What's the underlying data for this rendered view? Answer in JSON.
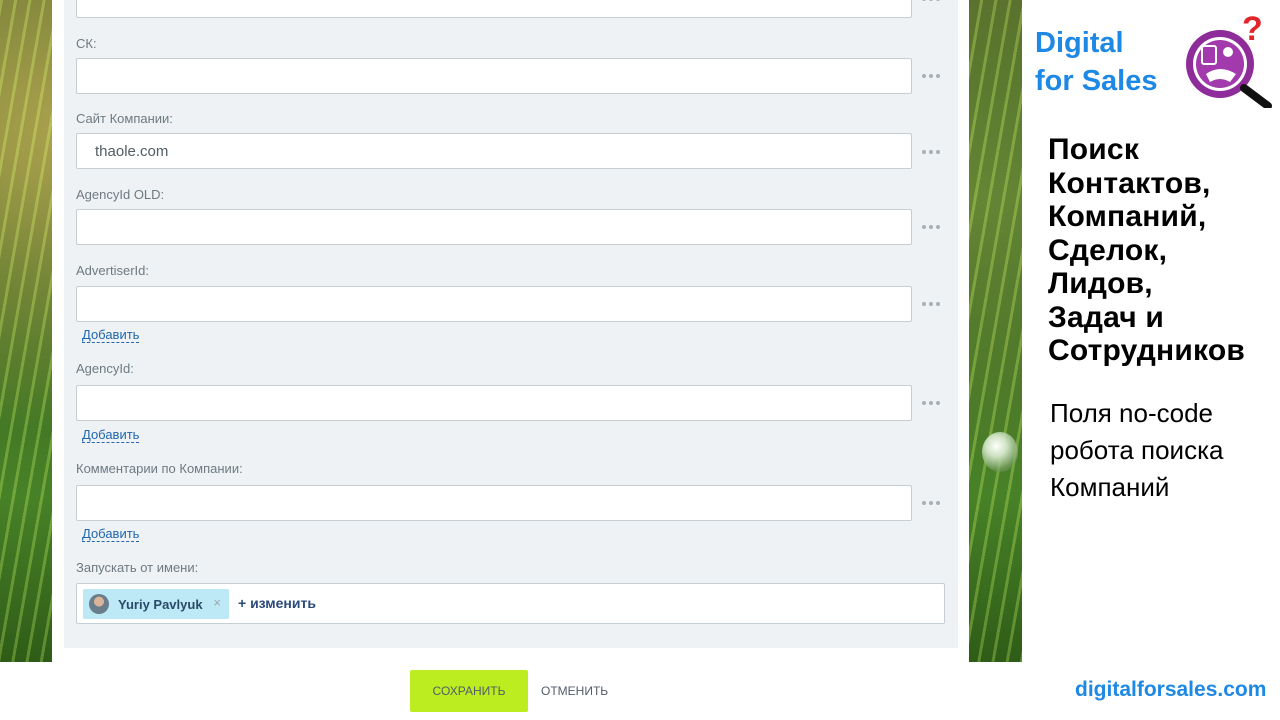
{
  "form": {
    "fields": [
      {
        "label": "",
        "value": ""
      },
      {
        "label": "СК:",
        "value": ""
      },
      {
        "label": "Сайт Компании:",
        "value": "thaole.com"
      },
      {
        "label": "AgencyId OLD:",
        "value": ""
      },
      {
        "label": "AdvertiserId:",
        "value": "",
        "add_label": "Добавить"
      },
      {
        "label": "AgencyId:",
        "value": "",
        "add_label": "Добавить"
      },
      {
        "label": "Комментарии по Компании:",
        "value": "",
        "add_label": "Добавить"
      }
    ],
    "run_as": {
      "label": "Запускать от имени:",
      "user_name": "Yuriy Pavlyuk",
      "remove_icon": "×",
      "change_label": "+ изменить"
    },
    "save_label": "СОХРАНИТЬ",
    "cancel_label": "ОТМЕНИТЬ"
  },
  "sidebar": {
    "brand_line1": "Digital",
    "brand_line2": "for Sales",
    "headline_lines": [
      "Поиск",
      "Контактов,",
      "Компаний,",
      "Сделок,",
      "Лидов,",
      "Задач и",
      "Сотрудников"
    ],
    "subtitle_lines": [
      "Поля no-code",
      "робота поиска",
      "Компаний"
    ],
    "url": "digitalforsales.com",
    "logo_mark": "?"
  },
  "colors": {
    "brand_blue": "#1e88e5",
    "save_green": "#bbed21",
    "logo_purple": "#8e2c9a",
    "logo_red": "#e0262b"
  }
}
